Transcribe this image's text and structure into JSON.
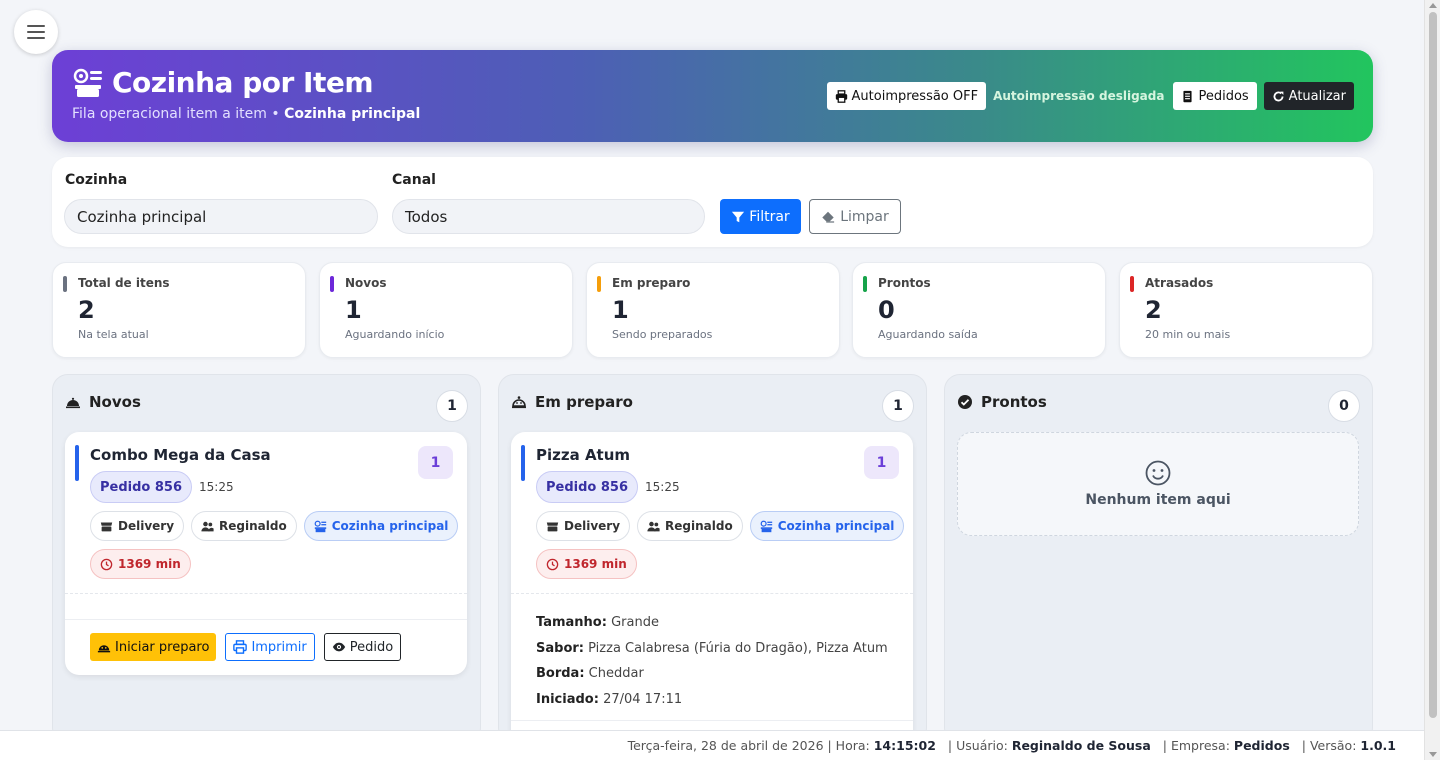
{
  "menu": {
    "icon": "hamburger-icon"
  },
  "header": {
    "title": "Cozinha por Item",
    "title_icon": "kitchen-icon",
    "subtitle": "Fila operacional item a item • ",
    "kitchen": "Cozinha principal",
    "autoprint_button": "Autoimpressão OFF",
    "autoprint_status": "Autoimpressão desligada",
    "orders_button": "Pedidos",
    "refresh_button": "Atualizar",
    "gradient_start": "#6d3fd6",
    "gradient_end": "#22c55e"
  },
  "filters": {
    "kitchen_label": "Cozinha",
    "kitchen_value": "Cozinha principal",
    "channel_label": "Canal",
    "channel_value": "Todos",
    "filter_button": "Filtrar",
    "clear_button": "Limpar"
  },
  "stats": [
    {
      "title": "Total de itens",
      "value": "2",
      "sub": "Na tela atual",
      "color": "#6b7280"
    },
    {
      "title": "Novos",
      "value": "1",
      "sub": "Aguardando início",
      "color": "#6d28d9"
    },
    {
      "title": "Em preparo",
      "value": "1",
      "sub": "Sendo preparados",
      "color": "#f59e0b"
    },
    {
      "title": "Prontos",
      "value": "0",
      "sub": "Aguardando saída",
      "color": "#16a34a"
    },
    {
      "title": "Atrasados",
      "value": "2",
      "sub": "20 min ou mais",
      "color": "#dc2626"
    }
  ],
  "columns": {
    "novos": {
      "title": "Novos",
      "count": "1",
      "card": {
        "name": "Combo Mega da Casa",
        "qty": "1",
        "order": "Pedido 856",
        "time": "15:25",
        "channel": "Delivery",
        "user": "Reginaldo",
        "kitchen": "Cozinha principal",
        "delay": "1369 min",
        "start_button": "Iniciar preparo",
        "print_button": "Imprimir",
        "order_button": "Pedido"
      }
    },
    "preparo": {
      "title": "Em preparo",
      "count": "1",
      "card": {
        "name": "Pizza Atum",
        "qty": "1",
        "order": "Pedido 856",
        "time": "15:25",
        "channel": "Delivery",
        "user": "Reginaldo",
        "kitchen": "Cozinha principal",
        "delay": "1369 min",
        "size_label": "Tamanho:",
        "size_value": "Grande",
        "flavor_label": "Sabor:",
        "flavor_value": "Pizza Calabresa (Fúria do Dragão), Pizza Atum",
        "crust_label": "Borda:",
        "crust_value": "Cheddar",
        "started_label": "Iniciado:",
        "started_value": "27/04 17:11"
      }
    },
    "prontos": {
      "title": "Prontos",
      "count": "0",
      "empty": "Nenhum item aqui"
    }
  },
  "footer": {
    "date": "Terça-feira, 28 de abril de 2026 | Hora:",
    "time": "14:15:02",
    "user_label": "| Usuário:",
    "user": "Reginaldo de Sousa",
    "company_label": "| Empresa:",
    "company": "Pedidos",
    "version_label": "| Versão:",
    "version": "1.0.1"
  }
}
